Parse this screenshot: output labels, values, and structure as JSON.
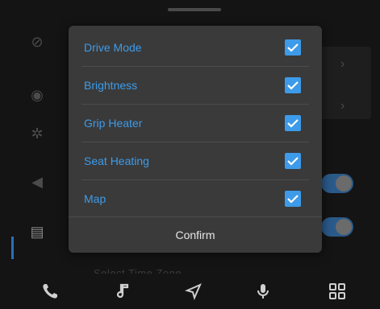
{
  "dialog": {
    "options": [
      {
        "label": "Drive Mode",
        "checked": true
      },
      {
        "label": "Brightness",
        "checked": true
      },
      {
        "label": "Grip Heater",
        "checked": true
      },
      {
        "label": "Seat Heating",
        "checked": true
      },
      {
        "label": "Map",
        "checked": true
      }
    ],
    "confirm_label": "Confirm"
  },
  "background": {
    "row_label": "Select Time Zone"
  },
  "bottom_nav": {
    "items": [
      "phone-icon",
      "music-icon",
      "navigation-icon",
      "microphone-icon",
      "apps-grid-icon"
    ]
  },
  "colors": {
    "accent": "#3d9be9",
    "dialog_bg": "#3a3a3a",
    "page_bg": "#141414"
  }
}
